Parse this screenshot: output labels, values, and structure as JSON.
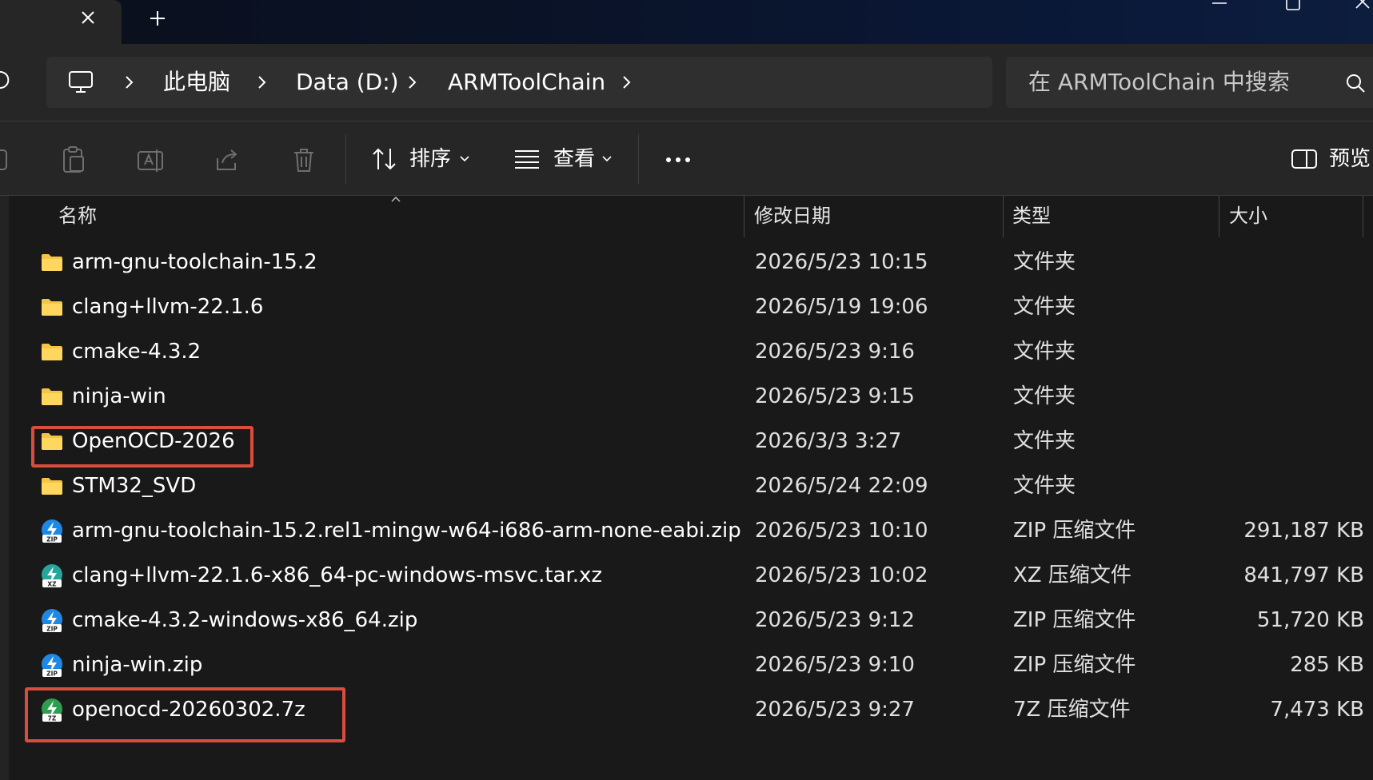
{
  "breadcrumb": {
    "items": [
      "此电脑",
      "Data (D:)",
      "ARMToolChain"
    ]
  },
  "search": {
    "placeholder": "在 ARMToolChain 中搜索"
  },
  "toolbar": {
    "sort_label": "排序",
    "view_label": "查看",
    "preview_label": "预览"
  },
  "columns": {
    "name": "名称",
    "date": "修改日期",
    "type": "类型",
    "size": "大小"
  },
  "files": [
    {
      "name": "arm-gnu-toolchain-15.2",
      "date": "2026/5/23 10:15",
      "type": "文件夹",
      "size": "",
      "icon": "folder-icon"
    },
    {
      "name": "clang+llvm-22.1.6",
      "date": "2026/5/19 19:06",
      "type": "文件夹",
      "size": "",
      "icon": "folder-icon"
    },
    {
      "name": "cmake-4.3.2",
      "date": "2026/5/23 9:16",
      "type": "文件夹",
      "size": "",
      "icon": "folder-icon"
    },
    {
      "name": "ninja-win",
      "date": "2026/5/23 9:15",
      "type": "文件夹",
      "size": "",
      "icon": "folder-icon"
    },
    {
      "name": "OpenOCD-2026",
      "date": "2026/3/3 3:27",
      "type": "文件夹",
      "size": "",
      "icon": "folder-icon"
    },
    {
      "name": "STM32_SVD",
      "date": "2026/5/24 22:09",
      "type": "文件夹",
      "size": "",
      "icon": "folder-icon"
    },
    {
      "name": "arm-gnu-toolchain-15.2.rel1-mingw-w64-i686-arm-none-eabi.zip",
      "date": "2026/5/23 10:10",
      "type": "ZIP 压缩文件",
      "size": "291,187 KB",
      "icon": "zip-archive-icon",
      "badge": "ZIP"
    },
    {
      "name": "clang+llvm-22.1.6-x86_64-pc-windows-msvc.tar.xz",
      "date": "2026/5/23 10:02",
      "type": "XZ 压缩文件",
      "size": "841,797 KB",
      "icon": "xz-archive-icon",
      "badge": "XZ"
    },
    {
      "name": "cmake-4.3.2-windows-x86_64.zip",
      "date": "2026/5/23 9:12",
      "type": "ZIP 压缩文件",
      "size": "51,720 KB",
      "icon": "zip-archive-icon",
      "badge": "ZIP"
    },
    {
      "name": "ninja-win.zip",
      "date": "2026/5/23 9:10",
      "type": "ZIP 压缩文件",
      "size": "285 KB",
      "icon": "zip-archive-icon",
      "badge": "ZIP"
    },
    {
      "name": "openocd-20260302.7z",
      "date": "2026/5/23 9:27",
      "type": "7Z 压缩文件",
      "size": "7,473 KB",
      "icon": "7z-archive-icon",
      "badge": "7Z"
    }
  ],
  "colors": {
    "highlight": "#d94d3d",
    "folder": "#f4c542",
    "zip": "#1e88e5",
    "xz": "#26a69a",
    "7z": "#2e9d4f"
  }
}
